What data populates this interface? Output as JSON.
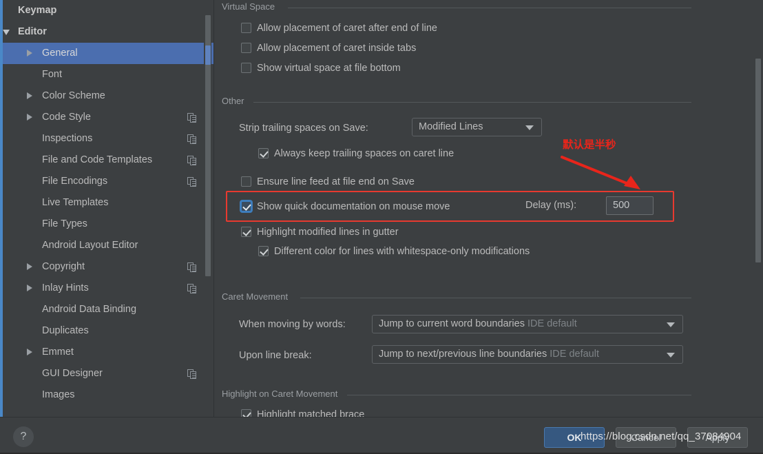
{
  "sidebar": {
    "items": [
      {
        "label": "Keymap",
        "indent": 22,
        "bold": true,
        "toggle": "none",
        "copy": false
      },
      {
        "label": "Editor",
        "indent": 22,
        "bold": true,
        "toggle": "down",
        "copy": false
      },
      {
        "label": "General",
        "indent": 57,
        "bold": false,
        "toggle": "right",
        "copy": false,
        "selected": true
      },
      {
        "label": "Font",
        "indent": 57,
        "bold": false,
        "toggle": "none",
        "copy": false
      },
      {
        "label": "Color Scheme",
        "indent": 57,
        "bold": false,
        "toggle": "right",
        "copy": false
      },
      {
        "label": "Code Style",
        "indent": 57,
        "bold": false,
        "toggle": "right",
        "copy": true
      },
      {
        "label": "Inspections",
        "indent": 57,
        "bold": false,
        "toggle": "none",
        "copy": true
      },
      {
        "label": "File and Code Templates",
        "indent": 57,
        "bold": false,
        "toggle": "none",
        "copy": true
      },
      {
        "label": "File Encodings",
        "indent": 57,
        "bold": false,
        "toggle": "none",
        "copy": true
      },
      {
        "label": "Live Templates",
        "indent": 57,
        "bold": false,
        "toggle": "none",
        "copy": false
      },
      {
        "label": "File Types",
        "indent": 57,
        "bold": false,
        "toggle": "none",
        "copy": false
      },
      {
        "label": "Android Layout Editor",
        "indent": 57,
        "bold": false,
        "toggle": "none",
        "copy": false
      },
      {
        "label": "Copyright",
        "indent": 57,
        "bold": false,
        "toggle": "right",
        "copy": true
      },
      {
        "label": "Inlay Hints",
        "indent": 57,
        "bold": false,
        "toggle": "right",
        "copy": true
      },
      {
        "label": "Android Data Binding",
        "indent": 57,
        "bold": false,
        "toggle": "none",
        "copy": false
      },
      {
        "label": "Duplicates",
        "indent": 57,
        "bold": false,
        "toggle": "none",
        "copy": false
      },
      {
        "label": "Emmet",
        "indent": 57,
        "bold": false,
        "toggle": "right",
        "copy": false
      },
      {
        "label": "GUI Designer",
        "indent": 57,
        "bold": false,
        "toggle": "none",
        "copy": true
      },
      {
        "label": "Images",
        "indent": 57,
        "bold": false,
        "toggle": "none",
        "copy": false
      }
    ]
  },
  "content": {
    "virtual_space": {
      "title": "Virtual Space",
      "options": [
        {
          "label": "Allow placement of caret after end of line",
          "checked": false
        },
        {
          "label": "Allow placement of caret inside tabs",
          "checked": false
        },
        {
          "label": "Show virtual space at file bottom",
          "checked": false
        }
      ]
    },
    "other": {
      "title": "Other",
      "strip_label": "Strip trailing spaces on Save:",
      "strip_value": "Modified Lines",
      "always_keep": {
        "label": "Always keep trailing spaces on caret line",
        "checked": true
      },
      "ensure_lf": {
        "label": "Ensure line feed at file end on Save",
        "checked": false
      },
      "quick_doc": {
        "label": "Show quick documentation on mouse move",
        "checked": true
      },
      "delay_label": "Delay (ms):",
      "delay_value": "500",
      "highlight_modified": {
        "label": "Highlight modified lines in gutter",
        "checked": true
      },
      "different_color": {
        "label": "Different color for lines with whitespace-only modifications",
        "checked": true
      }
    },
    "caret_movement": {
      "title": "Caret Movement",
      "when_moving_label": "When moving by words:",
      "when_moving_value": "Jump to current word boundaries",
      "when_moving_hint": "IDE default",
      "upon_line_break_label": "Upon line break:",
      "upon_line_break_value": "Jump to next/previous line boundaries",
      "upon_line_break_hint": "IDE default"
    },
    "highlight_caret": {
      "title": "Highlight on Caret Movement",
      "matched_brace": {
        "label": "Highlight matched brace",
        "checked": true
      }
    }
  },
  "annotation": {
    "text": "默认是半秒",
    "color": "#e8251b"
  },
  "footer": {
    "help_label": "?",
    "ok_label": "OK",
    "cancel_label": "Cancel",
    "apply_label": "Apply",
    "watermark": "https://blog.csdn.net/qq_37084904"
  }
}
